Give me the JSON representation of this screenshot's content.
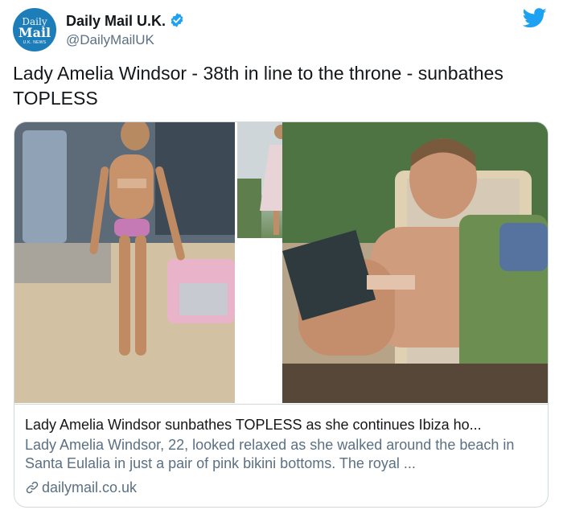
{
  "account": {
    "avatar_line1": "Daily",
    "avatar_line2": "Mail",
    "avatar_line3": "U.K. NEWS",
    "display_name": "Daily Mail U.K.",
    "handle": "@DailyMailUK",
    "verified": true
  },
  "tweet": {
    "text": "Lady Amelia Windsor - 38th in line to the throne - sunbathes TOPLESS"
  },
  "card": {
    "title": "Lady Amelia Windsor sunbathes TOPLESS as she continues Ibiza ho...",
    "description": "Lady Amelia Windsor, 22, looked relaxed as she walked around the beach in Santa Eulalia in just a pair of pink bikini bottoms. The royal ...",
    "domain": "dailymail.co.uk"
  },
  "icons": {
    "brand": "twitter-bird-icon",
    "verified": "verified-badge-icon",
    "link": "link-icon"
  },
  "colors": {
    "twitter_blue": "#1da1f2",
    "avatar_blue": "#1d7db8",
    "secondary_text": "#5b7083",
    "border": "#cfd9de"
  }
}
